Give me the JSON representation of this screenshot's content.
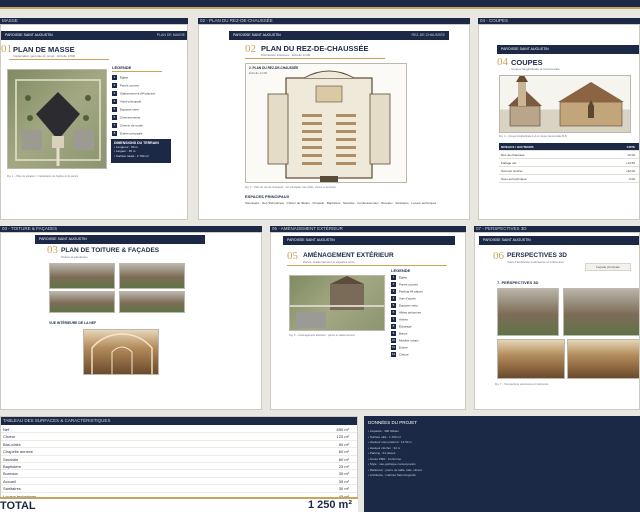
{
  "header": {
    "project_short": "PAROISSE SAINT AUGUSTIN"
  },
  "cards": {
    "masse": {
      "caption": "MASSE",
      "band_left": "PAROISSE SAINT AUGUSTIN",
      "band_right": "PLAN DE MASSE",
      "number": "01",
      "title": "PLAN DE MASSE",
      "subtitle": "Implantation générale du projet · Échelle 1/500",
      "legend_title": "LÉGENDE",
      "legend": [
        "Église",
        "Parvis couvert",
        "Stationnement (64 places)",
        "Voirie principale",
        "Espaces verts",
        "Cheminements",
        "Chemin de ronde",
        "Entrée principale",
        "Accès PMR",
        "Clôture"
      ],
      "dim_title": "DIMENSIONS DU TERRAIN",
      "dims": [
        "• Longueur : 60 m",
        "• Largeur : 45 m",
        "• Surface totale : 2 700 m²"
      ],
      "img_caption": "Fig. 1 – Plan de situation : implantation de l'église et du parvis"
    },
    "rdc": {
      "caption": "02 - PLAN DU REZ-DE-CHAUSSÉE",
      "band_left": "PAROISSE SAINT AUGUSTIN",
      "band_right": "REZ-DE-CHAUSSÉE",
      "number": "02",
      "title": "PLAN DU REZ-DE-CHAUSSÉE",
      "subtitle": "Distribution intérieure · Échelle 1/100",
      "plan_label": "2. PLAN DU REZ-DE-CHAUSSÉE",
      "plan_scale": "Échelle 1/100",
      "fig_caption": "Fig. 2 – Plan du rez-de-chaussée : nef principale, bas-côtés, chœur et annexes",
      "section_title": "ESPACES PRINCIPAUX",
      "section_text": "Sanctuaire · Nef (300 places) · Chœur de fidèles · Chapelle · Baptistère · Sacristie · Confessionnaux · Bureaux · Sanitaires · Locaux techniques"
    },
    "coupes": {
      "caption": "04 - COUPES",
      "band_left": "PAROISSE SAINT AUGUSTIN",
      "number": "04",
      "title": "COUPES",
      "subtitle": "Coupes longitudinale et transversale",
      "fig_caption": "Fig. 4 – Coupe longitudinale A-A et coupe transversale B-B",
      "table_head": [
        "NIVEAUX / HAUTEURS",
        "COTE"
      ],
      "table_rows": [
        [
          "Rez-de-chaussée",
          "±0.00"
        ],
        [
          "Faîtage nef",
          "+14.50"
        ],
        [
          "Sommet clocher",
          "+32.00"
        ],
        [
          "Sous-sol technique",
          "-3.00"
        ]
      ]
    },
    "facades": {
      "caption": "03 - TOITURE & FAÇADES",
      "band_left": "PAROISSE SAINT AUGUSTIN",
      "number": "03",
      "title": "PLAN DE TOITURE & FAÇADES",
      "subtitle": "Toiture et élévations",
      "interior_label": "VUE INTÉRIEURE DE LA NEF"
    },
    "exterieur": {
      "caption": "05 - AMÉNAGEMENT EXTÉRIEUR",
      "band_left": "PAROISSE SAINT AUGUSTIN",
      "number": "05",
      "title": "AMÉNAGEMENT EXTÉRIEUR",
      "subtitle": "Parvis, stationnement et espaces verts",
      "legend_title": "LÉGENDE",
      "legend": [
        "Église",
        "Parvis couvert",
        "Parking 64 places",
        "Voie d'accès",
        "Espaces verts",
        "Allées piétonnes",
        "Arbres",
        "Éclairage",
        "Bancs",
        "Mobilier urbain",
        "Entrée",
        "Clôture"
      ],
      "fig_caption": "Fig. 5 – Aménagement extérieur : parvis et stationnement"
    },
    "perspectives": {
      "caption": "07 - PERSPECTIVES 3D",
      "band_left": "PAROISSE SAINT AUGUSTIN",
      "number": "06",
      "title": "PERSPECTIVES 3D",
      "subtitle": "Vues d'ambiance extérieures et intérieures",
      "pill": "Façade principale",
      "label": "7. PERSPECTIVES 3D",
      "fig_caption": "Fig. 7 – Perspectives extérieures et intérieures"
    }
  },
  "surfaces": {
    "caption": "TABLEAU DES SURFACES & CARACTÉRISTIQUES",
    "rows": [
      [
        "Nef",
        "650 m²"
      ],
      [
        "Chœur",
        "120 m²"
      ],
      [
        "Bas-côtés",
        "80 m²"
      ],
      [
        "Chapelle annexe",
        "60 m²"
      ],
      [
        "Sacristie",
        "60 m²"
      ],
      [
        "Baptistère",
        "25 m²"
      ],
      [
        "Bureaux",
        "35 m²"
      ],
      [
        "Accueil",
        "35 m²"
      ],
      [
        "Sanitaires",
        "30 m²"
      ],
      [
        "Locaux techniques",
        "45 m²"
      ],
      [
        "Circulations",
        "150 m²"
      ]
    ],
    "total_label": "TOTAL",
    "total_value": "1 250 m²"
  },
  "project": {
    "title": "DONNÉES DU PROJET",
    "items": [
      "• Capacité : 300 fidèles",
      "• Surface utile : 1 250 m²",
      "• Hauteur sous plafond : 14.50 m",
      "• Hauteur clocher : 32 m",
      "• Parking : 64 places",
      "• Accès PMR : Conforme",
      "• Style : néo-gothique contemporain",
      "• Matériaux : pierre de taille, tuile, vitraux",
      "• Architecte : Cabinet Saint Augustin"
    ]
  },
  "colors": {
    "navy": "#1b2846",
    "gold": "#c9a45a",
    "paper": "#ffffff",
    "backdrop": "#e9e7e2"
  }
}
